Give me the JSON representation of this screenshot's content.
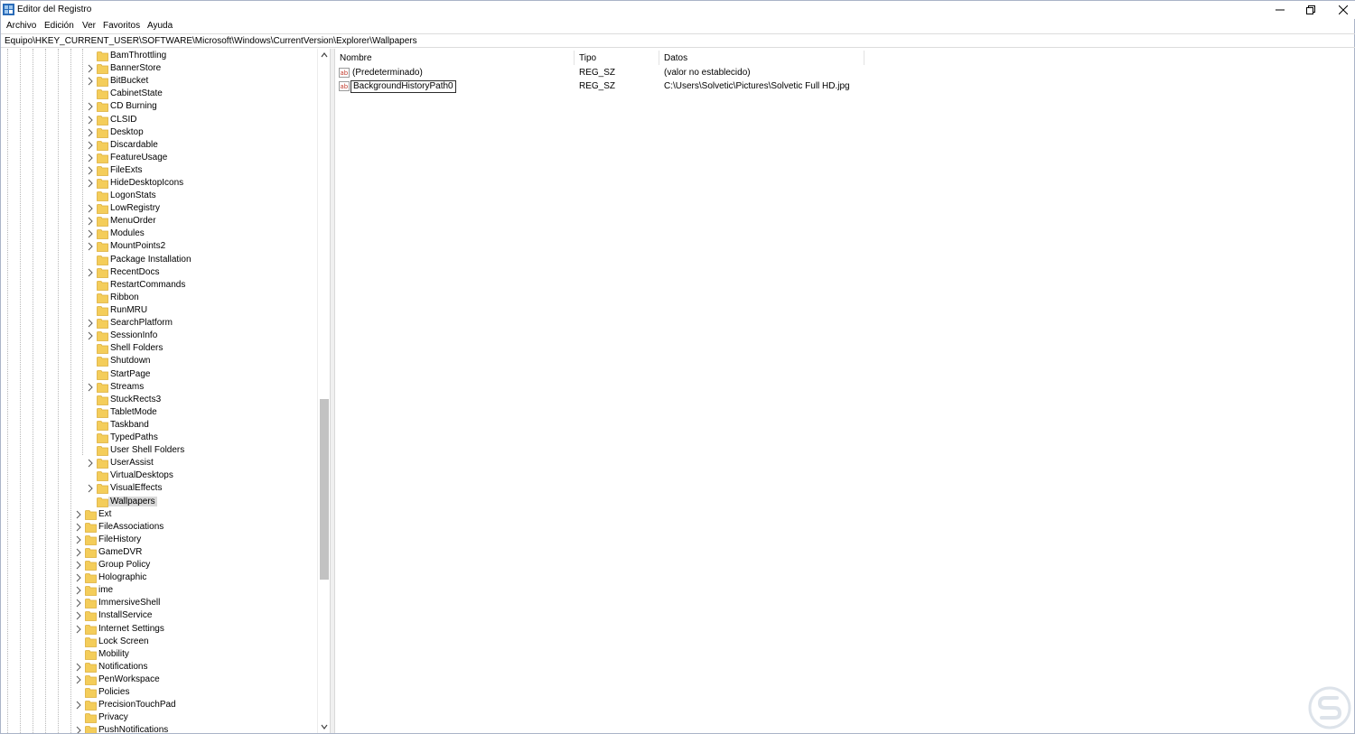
{
  "window": {
    "title": "Editor del Registro"
  },
  "menu": [
    "Archivo",
    "Edición",
    "Ver",
    "Favoritos",
    "Ayuda"
  ],
  "address": "Equipo\\HKEY_CURRENT_USER\\SOFTWARE\\Microsoft\\Windows\\CurrentVersion\\Explorer\\Wallpapers",
  "tree": {
    "explorer_children": [
      {
        "label": "BamThrottling",
        "expandable": false
      },
      {
        "label": "BannerStore",
        "expandable": true
      },
      {
        "label": "BitBucket",
        "expandable": true
      },
      {
        "label": "CabinetState",
        "expandable": false
      },
      {
        "label": "CD Burning",
        "expandable": true
      },
      {
        "label": "CLSID",
        "expandable": true
      },
      {
        "label": "Desktop",
        "expandable": true
      },
      {
        "label": "Discardable",
        "expandable": true
      },
      {
        "label": "FeatureUsage",
        "expandable": true
      },
      {
        "label": "FileExts",
        "expandable": true
      },
      {
        "label": "HideDesktopIcons",
        "expandable": true
      },
      {
        "label": "LogonStats",
        "expandable": false
      },
      {
        "label": "LowRegistry",
        "expandable": true
      },
      {
        "label": "MenuOrder",
        "expandable": true
      },
      {
        "label": "Modules",
        "expandable": true
      },
      {
        "label": "MountPoints2",
        "expandable": true
      },
      {
        "label": "Package Installation",
        "expandable": false
      },
      {
        "label": "RecentDocs",
        "expandable": true
      },
      {
        "label": "RestartCommands",
        "expandable": false
      },
      {
        "label": "Ribbon",
        "expandable": false
      },
      {
        "label": "RunMRU",
        "expandable": false
      },
      {
        "label": "SearchPlatform",
        "expandable": true
      },
      {
        "label": "SessionInfo",
        "expandable": true
      },
      {
        "label": "Shell Folders",
        "expandable": false
      },
      {
        "label": "Shutdown",
        "expandable": false
      },
      {
        "label": "StartPage",
        "expandable": false
      },
      {
        "label": "Streams",
        "expandable": true
      },
      {
        "label": "StuckRects3",
        "expandable": false
      },
      {
        "label": "TabletMode",
        "expandable": false
      },
      {
        "label": "Taskband",
        "expandable": false
      },
      {
        "label": "TypedPaths",
        "expandable": false
      },
      {
        "label": "User Shell Folders",
        "expandable": false
      },
      {
        "label": "UserAssist",
        "expandable": true
      },
      {
        "label": "VirtualDesktops",
        "expandable": false
      },
      {
        "label": "VisualEffects",
        "expandable": true
      },
      {
        "label": "Wallpapers",
        "expandable": false,
        "selected": true
      }
    ],
    "currentversion_children": [
      {
        "label": "Ext",
        "expandable": true
      },
      {
        "label": "FileAssociations",
        "expandable": true
      },
      {
        "label": "FileHistory",
        "expandable": true
      },
      {
        "label": "GameDVR",
        "expandable": true
      },
      {
        "label": "Group Policy",
        "expandable": true
      },
      {
        "label": "Holographic",
        "expandable": true
      },
      {
        "label": "ime",
        "expandable": true
      },
      {
        "label": "ImmersiveShell",
        "expandable": true
      },
      {
        "label": "InstallService",
        "expandable": true
      },
      {
        "label": "Internet Settings",
        "expandable": true
      },
      {
        "label": "Lock Screen",
        "expandable": false
      },
      {
        "label": "Mobility",
        "expandable": false
      },
      {
        "label": "Notifications",
        "expandable": true
      },
      {
        "label": "PenWorkspace",
        "expandable": true
      },
      {
        "label": "Policies",
        "expandable": false
      },
      {
        "label": "PrecisionTouchPad",
        "expandable": true
      },
      {
        "label": "Privacy",
        "expandable": false
      },
      {
        "label": "PushNotifications",
        "expandable": true
      }
    ]
  },
  "values": {
    "headers": {
      "name": "Nombre",
      "type": "Tipo",
      "data": "Datos"
    },
    "rows": [
      {
        "name": "(Predeterminado)",
        "type": "REG_SZ",
        "data": "(valor no establecido)",
        "icon": "string-value-icon"
      },
      {
        "name": "BackgroundHistoryPath0",
        "type": "REG_SZ",
        "data": "C:\\Users\\Solvetic\\Pictures\\Solvetic Full HD.jpg",
        "icon": "string-value-icon",
        "focused": true
      }
    ]
  },
  "colors": {
    "folder": "#f4cd5a",
    "folder_dark": "#dcae3a",
    "selection": "#d9d9d9",
    "icon_red": "#c0392b"
  }
}
